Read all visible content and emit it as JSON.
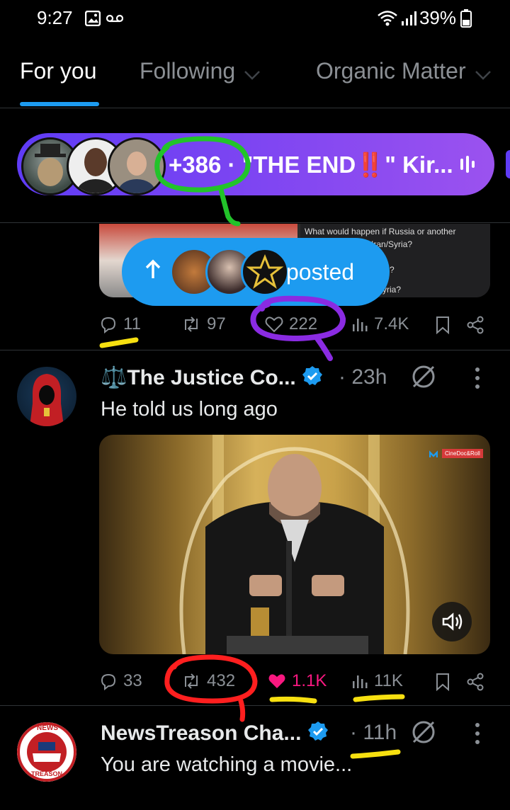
{
  "status_bar": {
    "time": "9:27",
    "battery": "39%"
  },
  "tabs": [
    {
      "label": "For you"
    },
    {
      "label": "Following"
    },
    {
      "label": "Organic Matter"
    }
  ],
  "space": {
    "count": "+386",
    "separator": "·",
    "title": "\"THE END‼️\" Kir..."
  },
  "prev_tweet": {
    "image_caption_1": "What would happen if Russia or another",
    "image_caption_2": "...lied Uranium to Iran/Syria?",
    "image_caption_3": "?",
    "image_caption_4": "...yria?",
    "replies": "11",
    "reposts": "97",
    "likes": "222",
    "views": "7.4K"
  },
  "toast": {
    "label": "posted"
  },
  "tweet1": {
    "name": "⚖️The Justice Co...",
    "time": "· 23h",
    "text": "He told us long ago",
    "video_watermark": "CineDoc&Roll",
    "replies": "33",
    "reposts": "432",
    "likes": "1.1K",
    "views": "11K"
  },
  "tweet2": {
    "name": "NewsTreason Cha...",
    "time": "· 11h",
    "text": "You are watching a movie...",
    "avatar_top": "NEWS",
    "avatar_bottom": "TREASON"
  },
  "colors": {
    "accent": "#1d9bf0",
    "like_active": "#f91880",
    "space_gradient_start": "#5f3cf6",
    "space_gradient_end": "#9b52ef",
    "annot_green": "#22c32a",
    "annot_yellow": "#f7e010",
    "annot_purple": "#8a2be2",
    "annot_red": "#ff1f1f"
  }
}
